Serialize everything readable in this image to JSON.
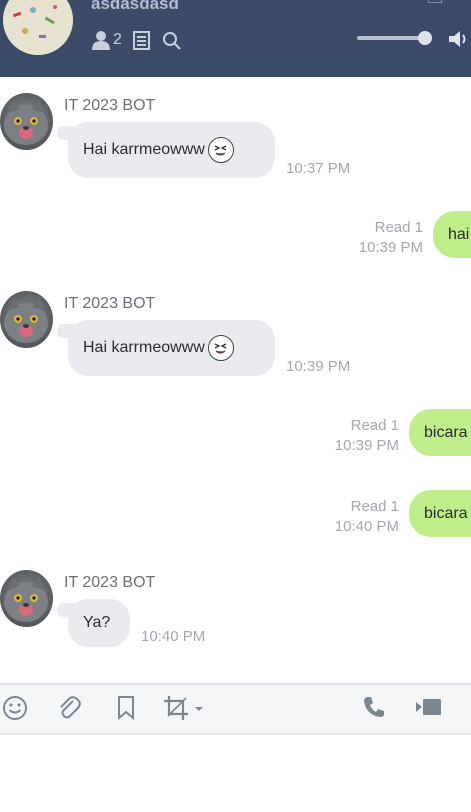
{
  "header": {
    "group_name": "asdasdasd",
    "member_count": "2",
    "icons": [
      "person-icon",
      "note-icon",
      "search-icon",
      "volume-slider",
      "speaker-icon"
    ]
  },
  "messages": [
    {
      "direction": "in",
      "sender": "IT 2023 BOT",
      "text": "Hai karrmeowww",
      "emoji": "laughing-emoji",
      "time": "10:37 PM"
    },
    {
      "direction": "out",
      "text": "hai",
      "read": "Read 1",
      "time": "10:39 PM"
    },
    {
      "direction": "in",
      "sender": "IT 2023 BOT",
      "text": "Hai karrmeowww",
      "emoji": "laughing-emoji",
      "time": "10:39 PM"
    },
    {
      "direction": "out",
      "text": "bicara",
      "read": "Read 1",
      "time": "10:39 PM"
    },
    {
      "direction": "out",
      "text": "bicara",
      "read": "Read 1",
      "time": "10:40 PM"
    },
    {
      "direction": "in",
      "sender": "IT 2023 BOT",
      "text": "Ya?",
      "time": "10:40 PM"
    }
  ],
  "toolbar": {
    "icons": [
      "emoji-icon",
      "attach-icon",
      "bookmark-icon",
      "crop-icon",
      "call-icon",
      "video-icon"
    ]
  },
  "colors": {
    "header_bg": "#3b4a66",
    "bubble_in": "#e9ebee",
    "bubble_out": "#bfee8b"
  }
}
